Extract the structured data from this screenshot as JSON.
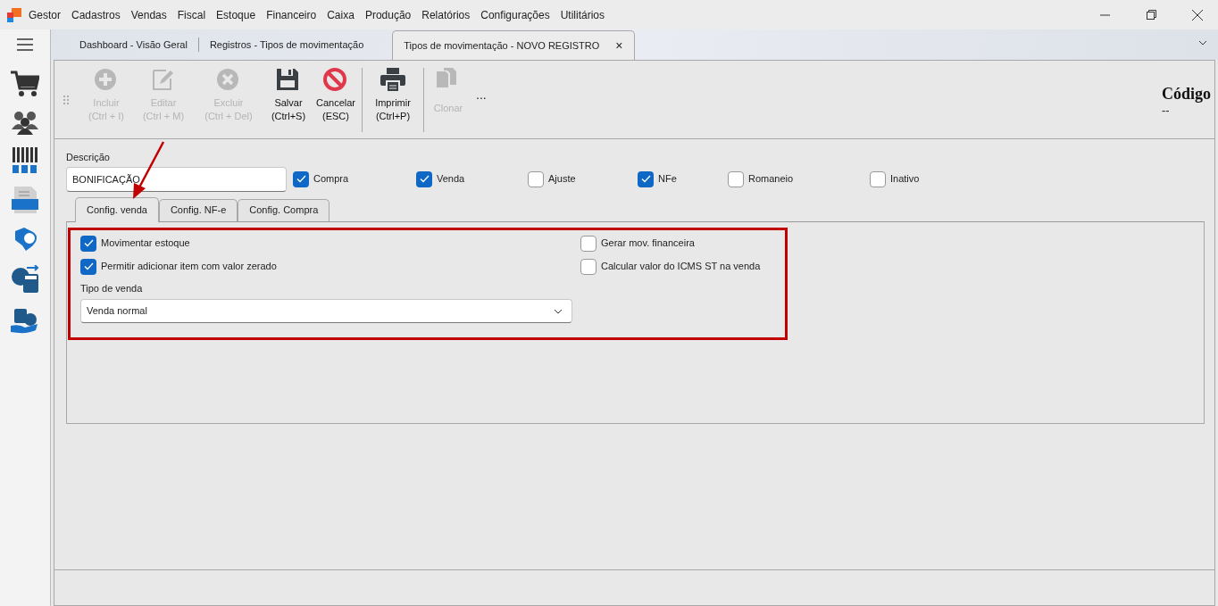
{
  "window": {
    "title": "Gestor"
  },
  "menu": [
    "Cadastros",
    "Vendas",
    "Fiscal",
    "Estoque",
    "Financeiro",
    "Caixa",
    "Produção",
    "Relatórios",
    "Configurações",
    "Utilitários"
  ],
  "doc_tabs": [
    {
      "label": "Dashboard - Visão Geral",
      "selected": false
    },
    {
      "label": "Registros - Tipos de movimentação",
      "selected": false
    },
    {
      "label": "Tipos de movimentação - NOVO REGISTRO",
      "selected": true,
      "close": "×"
    }
  ],
  "toolbar": [
    {
      "kind": "add",
      "label": "Incluir",
      "shortcut": "(Ctrl + I)",
      "disabled": true
    },
    {
      "kind": "edit",
      "label": "Editar",
      "shortcut": "(Ctrl + M)",
      "disabled": true
    },
    {
      "kind": "delete",
      "label": "Excluir",
      "shortcut": "(Ctrl + Del)",
      "disabled": true
    },
    {
      "kind": "save",
      "label": "Salvar",
      "shortcut": "(Ctrl+S)",
      "disabled": false
    },
    {
      "kind": "cancel",
      "label": "Cancelar",
      "shortcut": "(ESC)",
      "disabled": false
    },
    {
      "kind": "print",
      "label": "Imprimir",
      "shortcut": "(Ctrl+P)",
      "disabled": false
    },
    {
      "kind": "clone",
      "label": "Clonar",
      "disabled": true
    }
  ],
  "toolbar_more": "...",
  "code": {
    "label": "Código",
    "value": "--"
  },
  "description": {
    "label": "Descrição",
    "value": "BONIFICAÇÃO"
  },
  "flags": [
    {
      "label": "Compra",
      "checked": true
    },
    {
      "label": "Venda",
      "checked": true
    },
    {
      "label": "Ajuste",
      "checked": false
    },
    {
      "label": "NFe",
      "checked": true
    },
    {
      "label": "Romaneio",
      "checked": false
    },
    {
      "label": "Inativo",
      "checked": false
    }
  ],
  "config_tabs": [
    {
      "label": "Config. venda",
      "selected": true
    },
    {
      "label": "Config. NF-e",
      "selected": false
    },
    {
      "label": "Config. Compra",
      "selected": false
    }
  ],
  "sale_options_left": [
    {
      "label": "Movimentar estoque",
      "checked": true
    },
    {
      "label": "Permitir adicionar item com valor zerado",
      "checked": true
    }
  ],
  "sale_options_right": [
    {
      "label": "Gerar mov. financeira",
      "checked": false
    },
    {
      "label": "Calcular valor do ICMS ST na venda",
      "checked": false
    }
  ],
  "sale_type": {
    "label": "Tipo de venda",
    "value": "Venda normal"
  }
}
